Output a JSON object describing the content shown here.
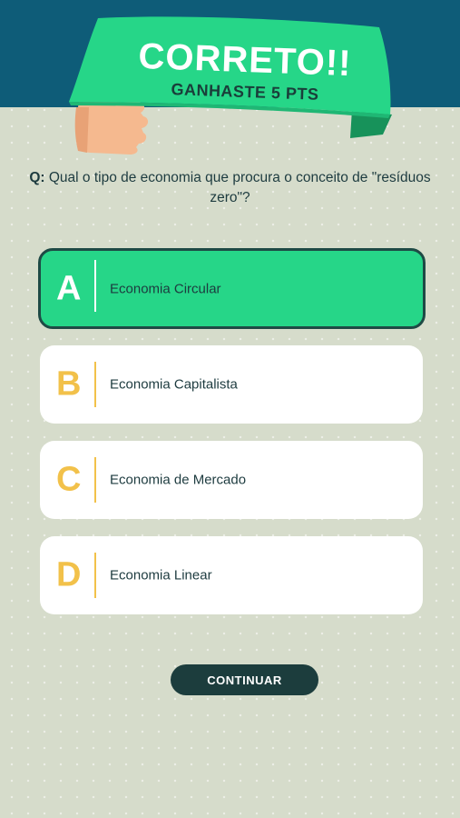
{
  "feedback": {
    "title": "CORRETO!!",
    "subtitle": "GANHASTE 5 PTS"
  },
  "question": {
    "prefix": "Q:",
    "text": "Qual o tipo de economia que procura o conceito de \"resíduos zero\"?"
  },
  "answers": [
    {
      "letter": "A",
      "label": "Economia Circular",
      "selected": true
    },
    {
      "letter": "B",
      "label": "Economia Capitalista",
      "selected": false
    },
    {
      "letter": "C",
      "label": "Economia de Mercado",
      "selected": false
    },
    {
      "letter": "D",
      "label": "Economia Linear",
      "selected": false
    }
  ],
  "actions": {
    "continue_label": "CONTINUAR"
  },
  "colors": {
    "header": "#0e5c78",
    "banner": "#26d688",
    "accent_letter": "#f2c14a",
    "background": "#d6dccb",
    "dark": "#1c3d3d"
  }
}
